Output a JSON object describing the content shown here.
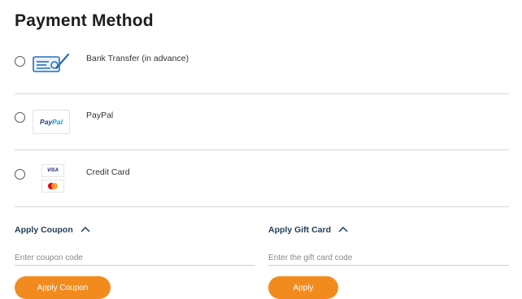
{
  "payment": {
    "title": "Payment Method",
    "methods": [
      {
        "label": "Bank Transfer (in advance)",
        "icon": "bank-transfer-icon"
      },
      {
        "label": "PayPal",
        "icon": "paypal-logo-icon",
        "logo_part1": "Pay",
        "logo_part2": "Pal"
      },
      {
        "label": "Credit Card",
        "icon": "credit-card-icon",
        "visa_text": "VISA"
      }
    ]
  },
  "coupon": {
    "title": "Apply Coupon",
    "placeholder": "Enter coupon code",
    "button_label": "Apply Coupon"
  },
  "gift_card": {
    "title": "Apply Gift Card",
    "placeholder": "Enter the gift card code",
    "button_label": "Apply"
  },
  "colors": {
    "accent_button": "#f28b1e",
    "section_title": "#1f3b57",
    "divider": "#d8d8d8"
  }
}
